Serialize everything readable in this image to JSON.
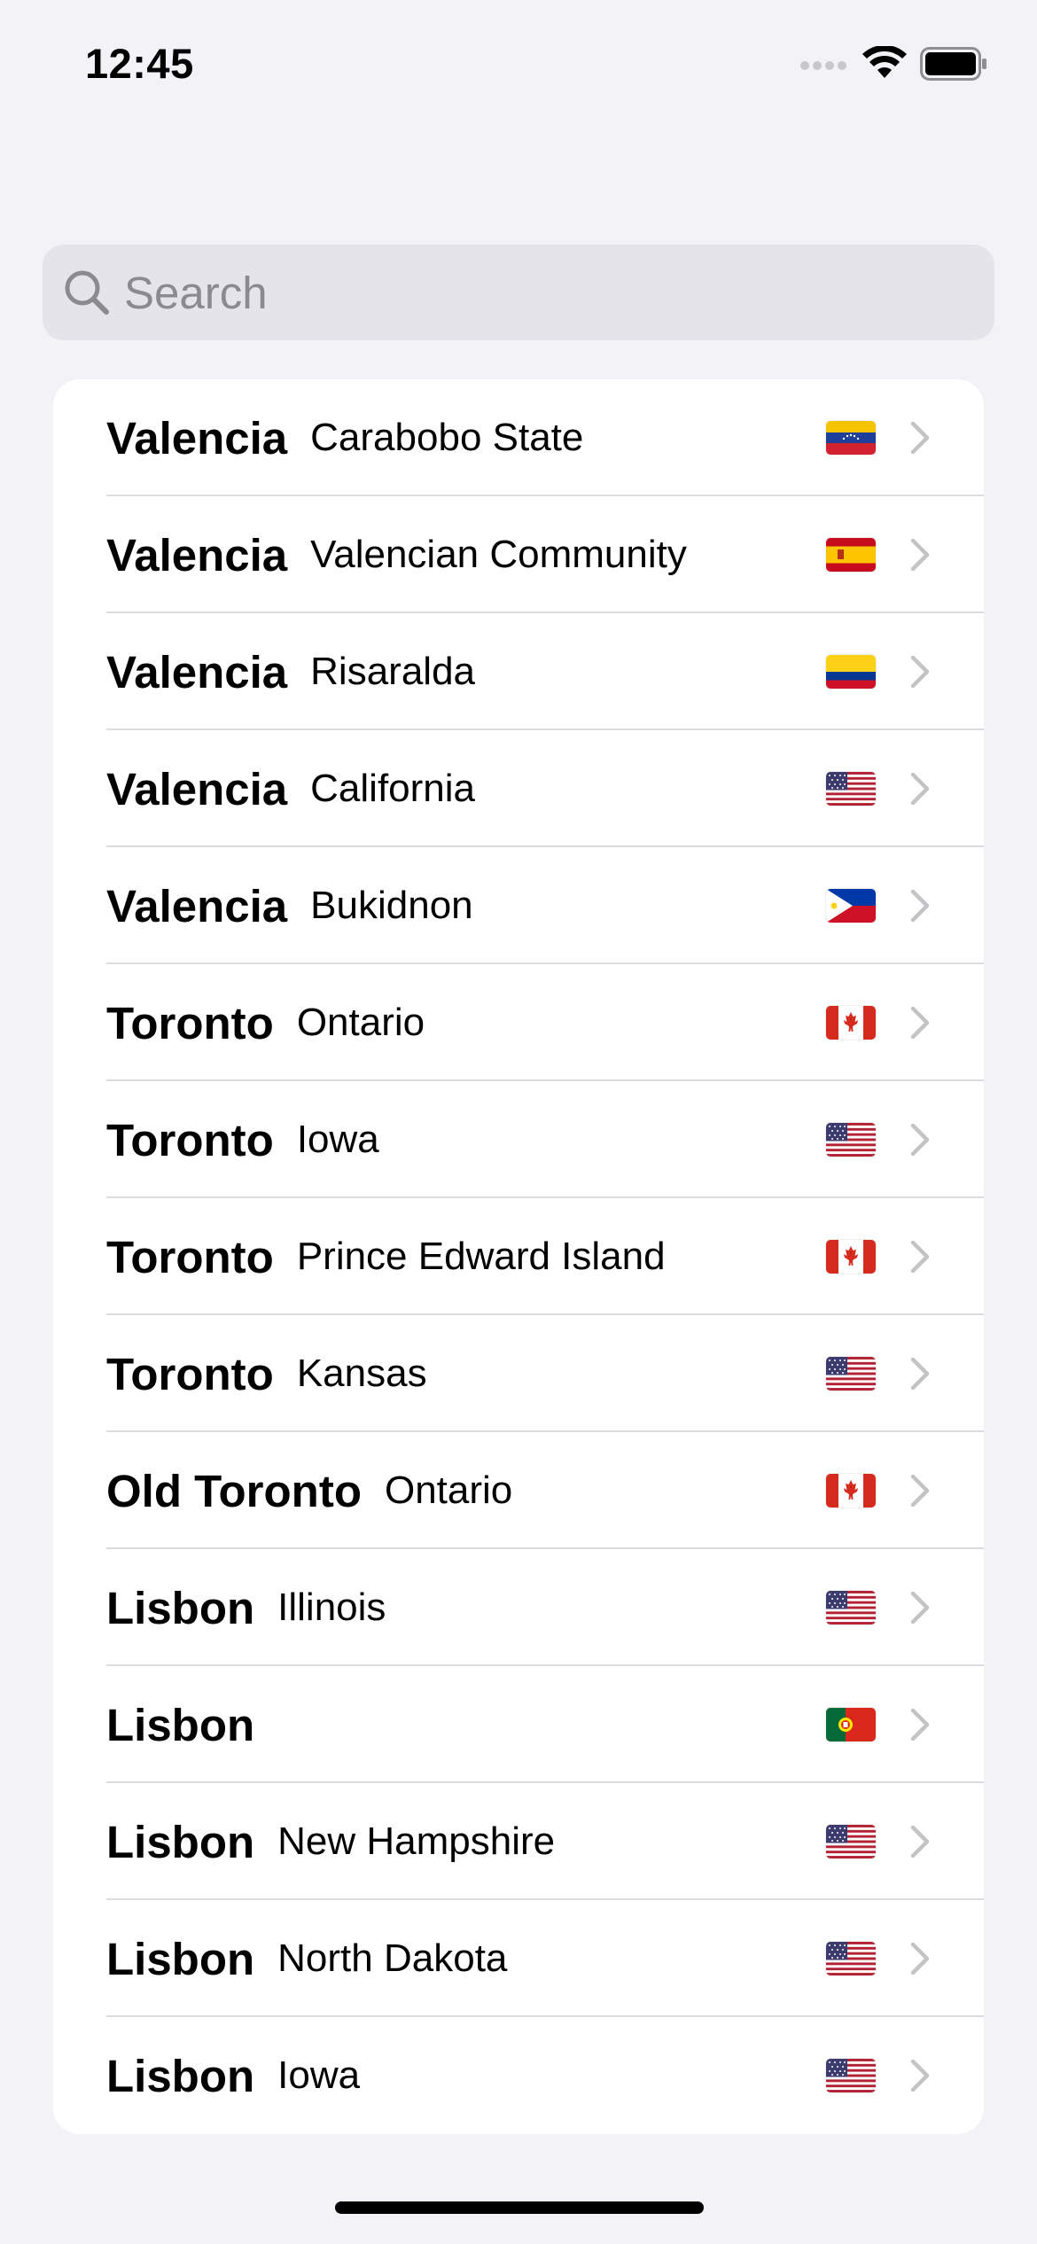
{
  "status_bar": {
    "time": "12:45",
    "icons": [
      "cellular-signal-icon",
      "wifi-icon",
      "battery-icon"
    ]
  },
  "search": {
    "placeholder": "Search",
    "value": ""
  },
  "results": [
    {
      "city": "Valencia",
      "region": "Carabobo State",
      "flag": "venezuela"
    },
    {
      "city": "Valencia",
      "region": "Valencian Community",
      "flag": "spain"
    },
    {
      "city": "Valencia",
      "region": "Risaralda",
      "flag": "colombia"
    },
    {
      "city": "Valencia",
      "region": "California",
      "flag": "usa"
    },
    {
      "city": "Valencia",
      "region": "Bukidnon",
      "flag": "philippines"
    },
    {
      "city": "Toronto",
      "region": "Ontario",
      "flag": "canada"
    },
    {
      "city": "Toronto",
      "region": "Iowa",
      "flag": "usa"
    },
    {
      "city": "Toronto",
      "region": "Prince Edward Island",
      "flag": "canada"
    },
    {
      "city": "Toronto",
      "region": "Kansas",
      "flag": "usa"
    },
    {
      "city": "Old Toronto",
      "region": "Ontario",
      "flag": "canada"
    },
    {
      "city": "Lisbon",
      "region": "Illinois",
      "flag": "usa"
    },
    {
      "city": "Lisbon",
      "region": "",
      "flag": "portugal"
    },
    {
      "city": "Lisbon",
      "region": "New Hampshire",
      "flag": "usa"
    },
    {
      "city": "Lisbon",
      "region": "North Dakota",
      "flag": "usa"
    },
    {
      "city": "Lisbon",
      "region": "Iowa",
      "flag": "usa"
    }
  ],
  "colors": {
    "background": "#f2f2f7",
    "search_fill": "#e4e4ea",
    "placeholder": "#8a8a8f",
    "chevron": "#c4c4c7",
    "separator": "#dcdce0"
  }
}
